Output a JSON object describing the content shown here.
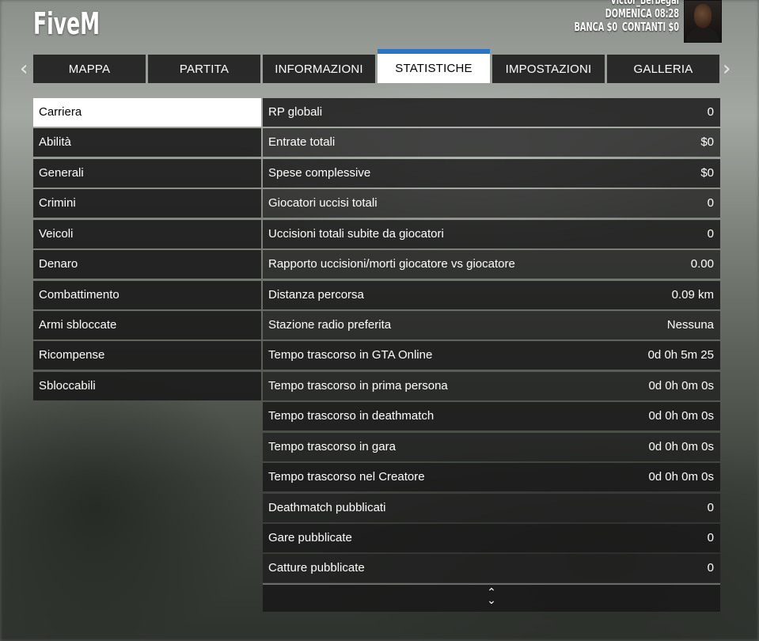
{
  "app": {
    "logo": "FiveM"
  },
  "player": {
    "name": "Victor_Berbegal",
    "datetime": "DOMENICA 08:28",
    "bank": "BANCA $0",
    "cash": "CONTANTI $0"
  },
  "tabs": [
    {
      "label": "MAPPA"
    },
    {
      "label": "PARTITA"
    },
    {
      "label": "INFORMAZIONI"
    },
    {
      "label": "STATISTICHE",
      "active": true
    },
    {
      "label": "IMPOSTAZIONI"
    },
    {
      "label": "GALLERIA"
    }
  ],
  "nav": {
    "prev_icon": "chevron-left-icon",
    "next_icon": "chevron-right-icon"
  },
  "sidebar": {
    "items": [
      {
        "label": "Carriera",
        "active": true
      },
      {
        "label": "Abilità"
      },
      {
        "label": "Generali"
      },
      {
        "label": "Crimini"
      },
      {
        "label": "Veicoli"
      },
      {
        "label": "Denaro"
      },
      {
        "label": "Combattimento"
      },
      {
        "label": "Armi sbloccate"
      },
      {
        "label": "Ricompense"
      },
      {
        "label": "Sbloccabili"
      }
    ]
  },
  "stats": {
    "rows": [
      {
        "label": "RP globali",
        "value": "0"
      },
      {
        "label": "Entrate totali",
        "value": "$0"
      },
      {
        "label": "Spese complessive",
        "value": "$0"
      },
      {
        "label": "Giocatori uccisi totali",
        "value": "0"
      },
      {
        "label": "Uccisioni totali subite da giocatori",
        "value": "0"
      },
      {
        "label": "Rapporto uccisioni/morti giocatore vs giocatore",
        "value": "0.00"
      },
      {
        "label": "Distanza percorsa",
        "value": "0.09 km"
      },
      {
        "label": "Stazione radio preferita",
        "value": "Nessuna"
      },
      {
        "label": "Tempo trascorso in GTA Online",
        "value": "0d 0h 5m 25"
      },
      {
        "label": "Tempo trascorso in prima persona",
        "value": "0d 0h 0m 0s"
      },
      {
        "label": "Tempo trascorso in deathmatch",
        "value": "0d 0h 0m 0s"
      },
      {
        "label": "Tempo trascorso in gara",
        "value": "0d 0h 0m 0s"
      },
      {
        "label": "Tempo trascorso nel Creatore",
        "value": "0d 0h 0m 0s"
      },
      {
        "label": "Deathmatch pubblicati",
        "value": "0"
      },
      {
        "label": "Gare pubblicate",
        "value": "0"
      },
      {
        "label": "Catture pubblicate",
        "value": "0"
      }
    ]
  },
  "scroll": {
    "icon": "scroll-up-down-icon"
  },
  "colors": {
    "accent": "#2a74c4",
    "panel": "#191919",
    "active_bg": "#ffffff"
  }
}
